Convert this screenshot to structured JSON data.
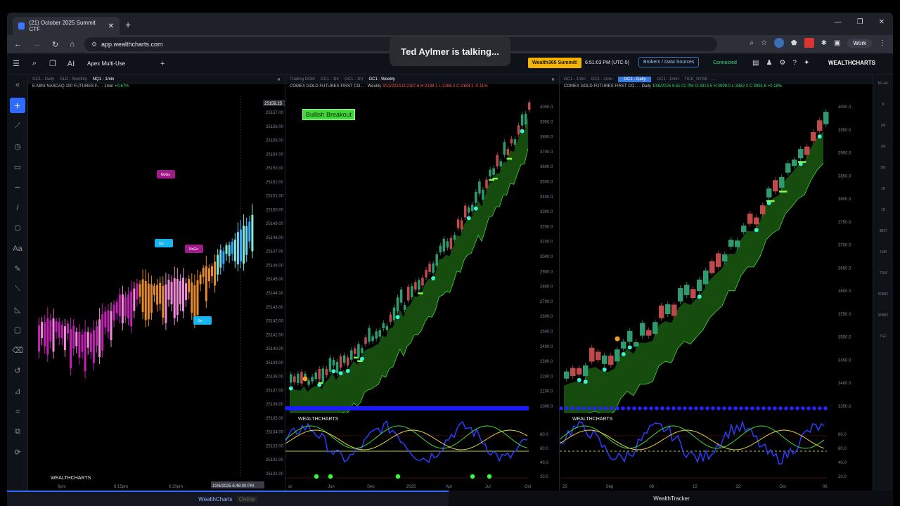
{
  "browser": {
    "tab_title": "(21) October 2025 Summit CTF",
    "url": "app.wealthcharts.com",
    "profile_label": "Work"
  },
  "toast": "Ted Aylmer is talking...",
  "app": {
    "layout_name": "Apex Multi-Use",
    "summit_badge": "Wealth365 Summit!",
    "clock": "6:51:03 PM (UTC-5)",
    "brokers_button": "Brokers / Data Sources",
    "connection_status": "Connected",
    "brand": "WEALTHCHARTS"
  },
  "panels": [
    {
      "tabs": [
        "GC1 - Daily",
        "GLD - Monthly",
        "NQ1 - 1min"
      ],
      "active_tab": "NQ1 - 1min",
      "title": "E-MINI NASDAQ 100 FUTURES F... - 1min",
      "change": "+0.67%",
      "price_tag": "25158.25",
      "y_ticks": [
        "25157.00",
        "25156.00",
        "25155.00",
        "25154.00",
        "25153.00",
        "25152.00",
        "25151.00",
        "25150.00",
        "25149.00",
        "25148.00",
        "25147.00",
        "25146.00",
        "25145.00",
        "25144.00",
        "25143.00",
        "25142.00",
        "25141.00",
        "25140.00",
        "25139.00",
        "25138.00",
        "25137.00",
        "25136.00",
        "25135.00",
        "25134.00",
        "25133.00",
        "25132.00",
        "25131.00"
      ],
      "x_ticks": [
        "6pm",
        "6:15pm",
        "6:30pm"
      ],
      "crosshair_date": "10/6/2025 6:48:00 PM",
      "markers": [
        "NoGo",
        "Go",
        "NoGo",
        "Go"
      ]
    },
    {
      "tabs": [
        "Trading DOM",
        "GC1 - 1hr",
        "GC1 - 1hr",
        "GC1 - Weekly"
      ],
      "active_tab": "GC1 - Weekly",
      "title": "COMEX GOLD FUTURES FIRST CO... - Weekly",
      "ohlc": "3/11/2024 O:2187.6 H:2198.1 L:2156.2 C:2183.1 -0.11%",
      "signal": "Bullish Breakout",
      "y_ticks": [
        "4000.0",
        "3900.0",
        "3800.0",
        "3700.0",
        "3600.0",
        "3500.0",
        "3400.0",
        "3300.0",
        "3200.0",
        "3100.0",
        "3000.0",
        "2900.0",
        "2800.0",
        "2700.0",
        "2600.0",
        "2500.0",
        "2400.0",
        "2300.0",
        "2200.0",
        "2100.0",
        "2000.0"
      ],
      "osc_ticks": [
        "80.0",
        "60.0",
        "40.0",
        "20.0"
      ],
      "x_ticks": [
        "ar",
        "Jun",
        "Sep",
        "2025",
        "Apr",
        "Jul",
        "Oct"
      ]
    },
    {
      "tabs": [
        "GC1 - 1min",
        "GC1 - 1min",
        "GC1 - Daily",
        "GC1 - 1min",
        "TICK_NYSE - ..."
      ],
      "active_tab": "GC1 - Daily",
      "title": "COMEX GOLD FUTURES FIRST CO... - Daily",
      "ohlc": "10/6/2025 6:51:02 PM O:3913.5 H:3999.0 L:3982.3 C:3991.6 +0.18%",
      "y_ticks": [
        "4000.0",
        "3950.0",
        "3900.0",
        "3850.0",
        "3800.0",
        "3750.0",
        "3700.0",
        "3650.0",
        "3600.0",
        "3550.0",
        "3500.0",
        "3450.0",
        "3400.0",
        "3350.0"
      ],
      "osc_ticks": [
        "80.0",
        "60.0",
        "40.0",
        "20.0"
      ],
      "x_ticks": [
        "25",
        "Sep",
        "08",
        "15",
        "22",
        "Oct",
        "06"
      ]
    }
  ],
  "right_rail": [
    "BS-AV",
    "B",
    "1M",
    "2M",
    "5M",
    "1H",
    "1D",
    "IBBT",
    "10M",
    "TSM",
    "IRBB2",
    "IRBB2",
    "TGC"
  ],
  "bottom": {
    "left_label": "WealthCharts",
    "left_badge": "Online",
    "right_label": "WealthTracker"
  },
  "colors": {
    "accent": "#2f6bff",
    "summit": "#f5b400",
    "bull": "#41d63c",
    "bear": "#ff5b5b",
    "magenta": "#c21fb4",
    "cloud": "#1a5a12"
  }
}
